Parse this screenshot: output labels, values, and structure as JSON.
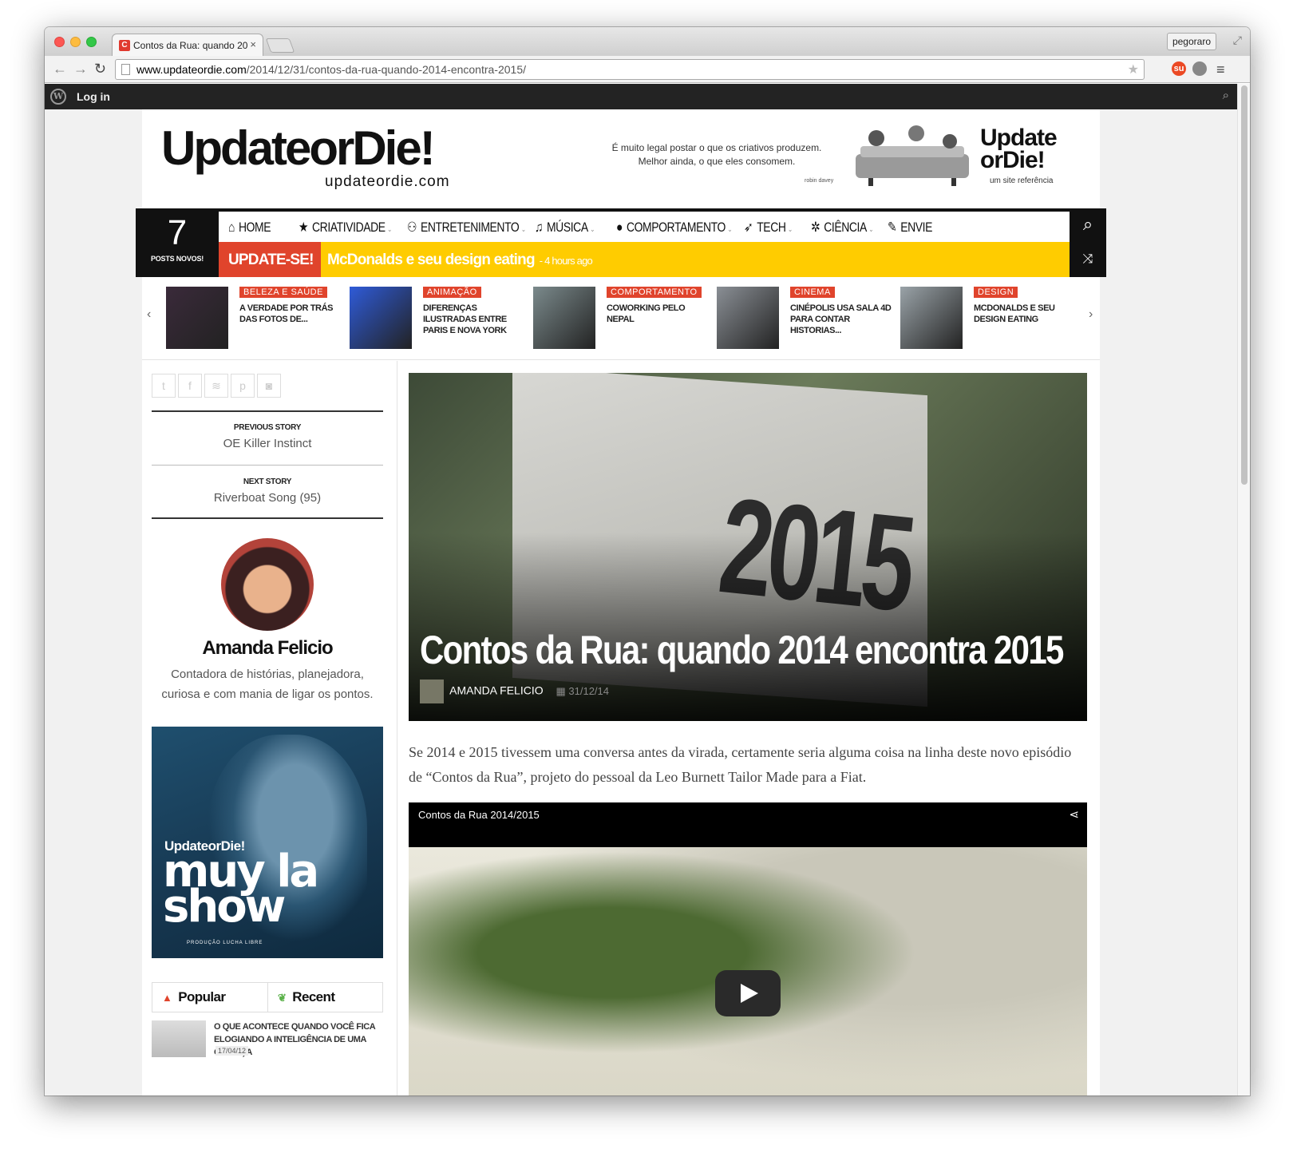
{
  "browser": {
    "tab_title": "Contos da Rua: quando 20",
    "tab_favicon": "C",
    "profile": "pegoraro",
    "url_host": "www.updateordie.com",
    "url_path": "/2014/12/31/contos-da-rua-quando-2014-encontra-2015/",
    "extension_label": "su"
  },
  "wpbar": {
    "login": "Log in"
  },
  "site": {
    "logo_main": "UpdateorDie!",
    "logo_sub": "updateordie.com",
    "header_quote": "É muito legal postar o que os criativos produzem. Melhor ainda, o que eles consomem.",
    "header_credit": "robin davey",
    "header_logo_line1": "Update",
    "header_logo_line2": "orDie!",
    "header_logo_sub": "um site referência"
  },
  "nav": {
    "count": "7",
    "count_label": "POSTS NOVOS!",
    "items": [
      {
        "label": "HOME",
        "icon": "home-icon",
        "glyph": "⌂",
        "caret": ""
      },
      {
        "label": "CRIATIVIDADE",
        "icon": "star-icon",
        "glyph": "★",
        "caret": "⌄"
      },
      {
        "label": "ENTRETENIMENTO",
        "icon": "gamepad-icon",
        "glyph": "⚇",
        "caret": "⌄"
      },
      {
        "label": "MÚSICA",
        "icon": "music-icon",
        "glyph": "♫",
        "caret": "⌄"
      },
      {
        "label": "COMPORTAMENTO",
        "icon": "user-icon",
        "glyph": "●",
        "caret": "⌄"
      },
      {
        "label": "TECH",
        "icon": "rocket-icon",
        "glyph": "➶",
        "caret": "⌄"
      },
      {
        "label": "CIÊNCIA",
        "icon": "bug-icon",
        "glyph": "✲",
        "caret": "⌄"
      },
      {
        "label": "ENVIE",
        "icon": "pencil-icon",
        "glyph": "✎",
        "caret": ""
      }
    ],
    "ticker_label": "UPDATE-SE!",
    "ticker_text": "McDonalds e seu design eating",
    "ticker_time": "- 4 hours ago"
  },
  "carousel": [
    {
      "category": "BELEZA E SAÚDE",
      "title": "A VERDADE POR TRÁS DAS FOTOS DE...",
      "thumb_color": "#3a2a3a"
    },
    {
      "category": "ANIMAÇÃO",
      "title": "DIFERENÇAS ILUSTRADAS ENTRE PARIS E NOVA YORK",
      "thumb_color": "#2f5bd8"
    },
    {
      "category": "COMPORTAMENTO",
      "title": "COWORKING PELO NEPAL",
      "thumb_color": "#7b8a8c"
    },
    {
      "category": "CINEMA",
      "title": "CINÉPOLIS USA SALA 4D PARA CONTAR HISTORIAS...",
      "thumb_color": "#8a8f95"
    },
    {
      "category": "DESIGN",
      "title": "MCDONALDS E SEU DESIGN EATING",
      "thumb_color": "#9aa3a8"
    }
  ],
  "sidebar": {
    "social": [
      {
        "icon": "twitter-icon",
        "glyph": "t"
      },
      {
        "icon": "facebook-icon",
        "glyph": "f"
      },
      {
        "icon": "spotify-icon",
        "glyph": "≋"
      },
      {
        "icon": "pinterest-icon",
        "glyph": "p"
      },
      {
        "icon": "instagram-icon",
        "glyph": "◙"
      }
    ],
    "prev_label": "PREVIOUS STORY",
    "prev_title": "OE Killer Instinct",
    "next_label": "NEXT STORY",
    "next_title": "Riverboat Song (95)",
    "author_name": "Amanda Felicio",
    "author_bio": "Contadora de histórias, planejadora, curiosa e com mania de ligar os pontos.",
    "promo_brand": "UpdateorDie!",
    "promo_title": "muy la show",
    "promo_credit": "PRODUÇÃO LUCHA LIBRE",
    "tab_popular": "Popular",
    "tab_recent": "Recent",
    "popular_title": "O QUE ACONTECE QUANDO VOCÊ FICA ELOGIANDO A INTELIGÊNCIA DE UMA CRIANÇA",
    "popular_date": "17/04/12"
  },
  "article": {
    "title": "Contos da Rua: quando 2014 encontra 2015",
    "author": "AMANDA FELICIO",
    "date": "31/12/14",
    "hero_text": "2015",
    "intro": "Se 2014 e 2015 tivessem uma conversa antes da virada, certamente seria alguma coisa na linha deste novo episódio de “Contos da Rua”, projeto do pessoal da Leo Burnett Tailor Made para a Fiat.",
    "video_title": "Contos da Rua 2014/2015"
  },
  "colors": {
    "accent_red": "#e0442c",
    "ticker_yellow": "#ffcc00",
    "nav_black": "#111111"
  }
}
